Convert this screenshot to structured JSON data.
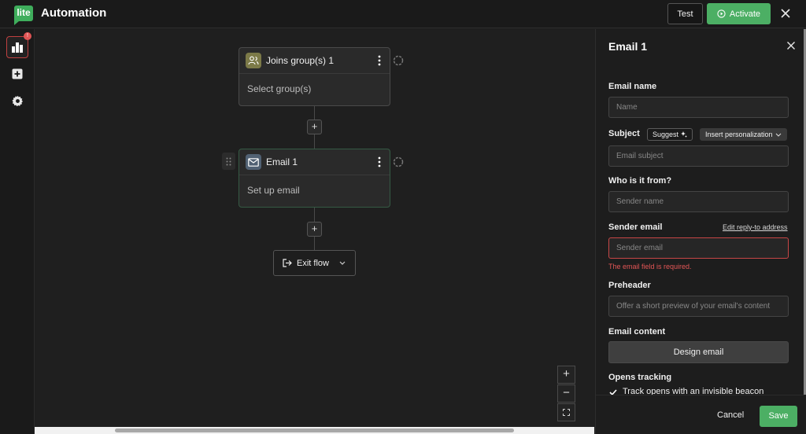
{
  "header": {
    "logo_text": "lite",
    "title": "Automation",
    "test_label": "Test",
    "activate_label": "Activate"
  },
  "sidebar": {
    "badge": "!",
    "items": [
      {
        "icon": "bar-chart-icon"
      },
      {
        "icon": "add-box-icon"
      },
      {
        "icon": "gear-icon"
      }
    ]
  },
  "canvas": {
    "nodes": [
      {
        "title": "Joins group(s) 1",
        "body": "Select group(s)",
        "icon": "group-icon"
      },
      {
        "title": "Email 1",
        "body": "Set up email",
        "icon": "mail-icon"
      }
    ],
    "plus": "+",
    "exit_label": "Exit flow",
    "zoom_in": "+",
    "zoom_out": "−"
  },
  "panel": {
    "title": "Email 1",
    "email_name_label": "Email name",
    "email_name_placeholder": "Name",
    "subject_label": "Subject",
    "suggest_label": "Suggest",
    "insert_label": "Insert personalization",
    "subject_placeholder": "Email subject",
    "from_label": "Who is it from?",
    "sender_name_placeholder": "Sender name",
    "sender_email_label": "Sender email",
    "edit_reply_label": "Edit reply-to address",
    "sender_email_placeholder": "Sender email",
    "sender_email_error": "The email field is required.",
    "preheader_label": "Preheader",
    "preheader_placeholder": "Offer a short preview of your email's content",
    "content_label": "Email content",
    "design_label": "Design email",
    "tracking_label": "Opens tracking",
    "track_opens_label": "Track opens with an invisible beacon",
    "cancel_label": "Cancel",
    "save_label": "Save"
  },
  "colors": {
    "accent": "#4caf64",
    "error": "#e25555",
    "background": "#1e1e1e"
  }
}
